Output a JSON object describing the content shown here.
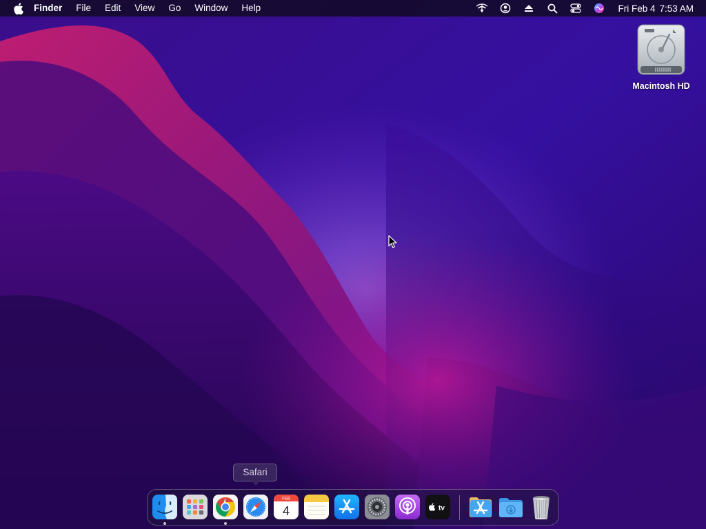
{
  "menubar": {
    "app_name": "Finder",
    "menus": [
      "File",
      "Edit",
      "View",
      "Go",
      "Window",
      "Help"
    ],
    "status_icons": [
      "wifi-icon",
      "user-account-icon",
      "eject-icon",
      "spotlight-search-icon",
      "control-center-icon",
      "siri-icon"
    ],
    "clock": {
      "date": "Fri Feb 4",
      "time": "7:53 AM"
    }
  },
  "desktop": {
    "icons": [
      {
        "label": "Macintosh HD",
        "icon": "hard-drive-icon"
      }
    ]
  },
  "tooltip": {
    "text": "Safari"
  },
  "dock": {
    "calendar": {
      "month": "FEB",
      "day": "4"
    },
    "apps": [
      {
        "name": "Finder",
        "icon": "finder-icon",
        "running": true
      },
      {
        "name": "Launchpad",
        "icon": "launchpad-icon",
        "running": false
      },
      {
        "name": "Google Chrome",
        "icon": "chrome-icon",
        "running": true
      },
      {
        "name": "Safari",
        "icon": "safari-icon",
        "running": false
      },
      {
        "name": "Calendar",
        "icon": "calendar-icon",
        "running": false
      },
      {
        "name": "Notes",
        "icon": "notes-icon",
        "running": false
      },
      {
        "name": "App Store",
        "icon": "app-store-icon",
        "running": false
      },
      {
        "name": "System Preferences",
        "icon": "system-preferences-icon",
        "running": false
      },
      {
        "name": "Podcasts",
        "icon": "podcasts-icon",
        "running": false
      },
      {
        "name": "Apple TV",
        "icon": "apple-tv-icon",
        "running": false
      },
      {
        "name": "Applications",
        "icon": "applications-folder-icon",
        "running": false
      },
      {
        "name": "Downloads",
        "icon": "downloads-folder-icon",
        "running": false
      },
      {
        "name": "Trash",
        "icon": "trash-icon",
        "running": false
      }
    ]
  },
  "colors": {
    "menubar_bg": "#140a28",
    "wallpaper_base": "#2a0a6e",
    "wallpaper_accent": "#b0166e"
  }
}
